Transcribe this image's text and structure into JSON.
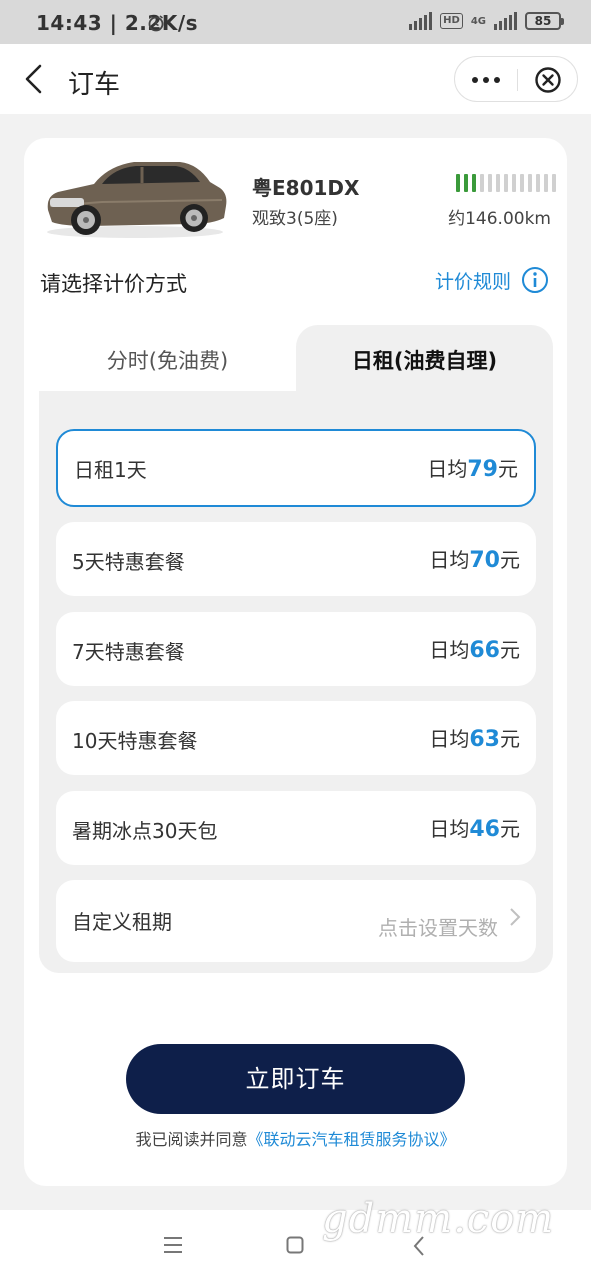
{
  "status": {
    "time": "14:43 | 2.2K/s",
    "hd": "HD",
    "net": "4G",
    "battery": "85"
  },
  "nav": {
    "title": "订车"
  },
  "car": {
    "plate": "粤E801DX",
    "model": "观致3(5座)",
    "range": "约146.00km",
    "battery_level": 3,
    "battery_total": 13
  },
  "pricing": {
    "title": "请选择计价方式",
    "rule_link": "计价规则"
  },
  "tabs": [
    {
      "label": "分时(免油费)",
      "active": false
    },
    {
      "label": "日租(油费自理)",
      "active": true
    }
  ],
  "options": [
    {
      "label": "日租1天",
      "prefix": "日均",
      "value": "79",
      "unit": "元",
      "selected": true
    },
    {
      "label": "5天特惠套餐",
      "prefix": "日均",
      "value": "70",
      "unit": "元",
      "selected": false
    },
    {
      "label": "7天特惠套餐",
      "prefix": "日均",
      "value": "66",
      "unit": "元",
      "selected": false
    },
    {
      "label": "10天特惠套餐",
      "prefix": "日均",
      "value": "63",
      "unit": "元",
      "selected": false
    },
    {
      "label": "暑期冰点30天包",
      "prefix": "日均",
      "value": "46",
      "unit": "元",
      "selected": false
    }
  ],
  "custom": {
    "label": "自定义租期",
    "hint": "点击设置天数"
  },
  "book_button": "立即订车",
  "agreement": {
    "prefix": "我已阅读并同意",
    "link": "《联动云汽车租赁服务协议》"
  },
  "watermark": "gdmm.com",
  "colors": {
    "accent": "#1f8ad6",
    "button": "#0e1f4a",
    "battery_on": "#3a9a3a"
  }
}
